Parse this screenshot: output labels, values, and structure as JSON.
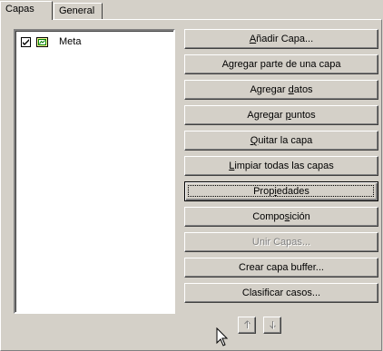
{
  "tabs": [
    {
      "label": "Capas"
    },
    {
      "label": "General"
    }
  ],
  "layers": [
    {
      "name": "Meta",
      "checked": true
    }
  ],
  "buttons": {
    "add_layer": {
      "pre": "",
      "u": "A",
      "post": "ñadir Capa..."
    },
    "add_part": {
      "pre": "Agregar parte de una capa",
      "u": "",
      "post": ""
    },
    "add_data": {
      "pre": "Agregar ",
      "u": "d",
      "post": "atos"
    },
    "add_points": {
      "pre": "Agregar ",
      "u": "p",
      "post": "untos"
    },
    "remove_layer": {
      "pre": "",
      "u": "Q",
      "post": "uitar la capa"
    },
    "clear_layers": {
      "pre": "",
      "u": "L",
      "post": "impiar todas las capas"
    },
    "properties": {
      "pre": "Prop",
      "u": "i",
      "post": "edades"
    },
    "composition": {
      "pre": "Compo",
      "u": "s",
      "post": "ición"
    },
    "join_layers": {
      "pre": "Unir Capas...",
      "u": "",
      "post": ""
    },
    "buffer_layer": {
      "pre": "Crear capa buffer...",
      "u": "",
      "post": ""
    },
    "classify_cases": {
      "pre": "Clasificar casos...",
      "u": "",
      "post": ""
    }
  },
  "icons": {
    "layer": "layer-map-icon",
    "move_up": "arrow-up-icon",
    "move_down": "arrow-down-icon",
    "cursor": "mouse-pointer-icon"
  }
}
